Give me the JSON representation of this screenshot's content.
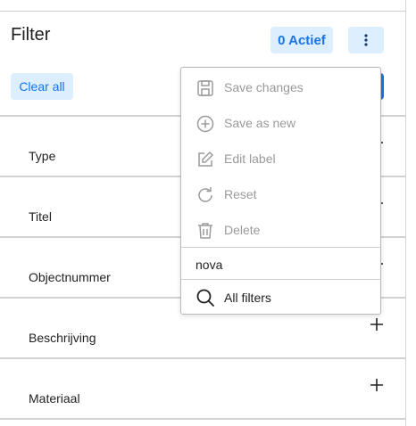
{
  "header": {
    "title": "Filter",
    "active_label": "0 Actief"
  },
  "toolbar": {
    "clear_label": "Clear all"
  },
  "filters": [
    {
      "label": "Type"
    },
    {
      "label": "Titel"
    },
    {
      "label": "Objectnummer"
    },
    {
      "label": "Beschrijving"
    },
    {
      "label": "Materiaal"
    }
  ],
  "menu": {
    "items": [
      {
        "label": "Save changes",
        "icon": "floppy-disk-icon",
        "disabled": true
      },
      {
        "label": "Save as new",
        "icon": "plus-circle-icon",
        "disabled": true
      },
      {
        "label": "Edit label",
        "icon": "edit-icon",
        "disabled": true
      },
      {
        "label": "Reset",
        "icon": "reset-icon",
        "disabled": true
      },
      {
        "label": "Delete",
        "icon": "trash-icon",
        "disabled": true
      }
    ],
    "saved_filter_name": "nova",
    "all_filters_label": "All filters"
  },
  "colors": {
    "accent": "#1a73e8",
    "accent_bg": "#ddeeff",
    "disabled_text": "#9a9a9a",
    "divider": "#d2d2d2"
  }
}
